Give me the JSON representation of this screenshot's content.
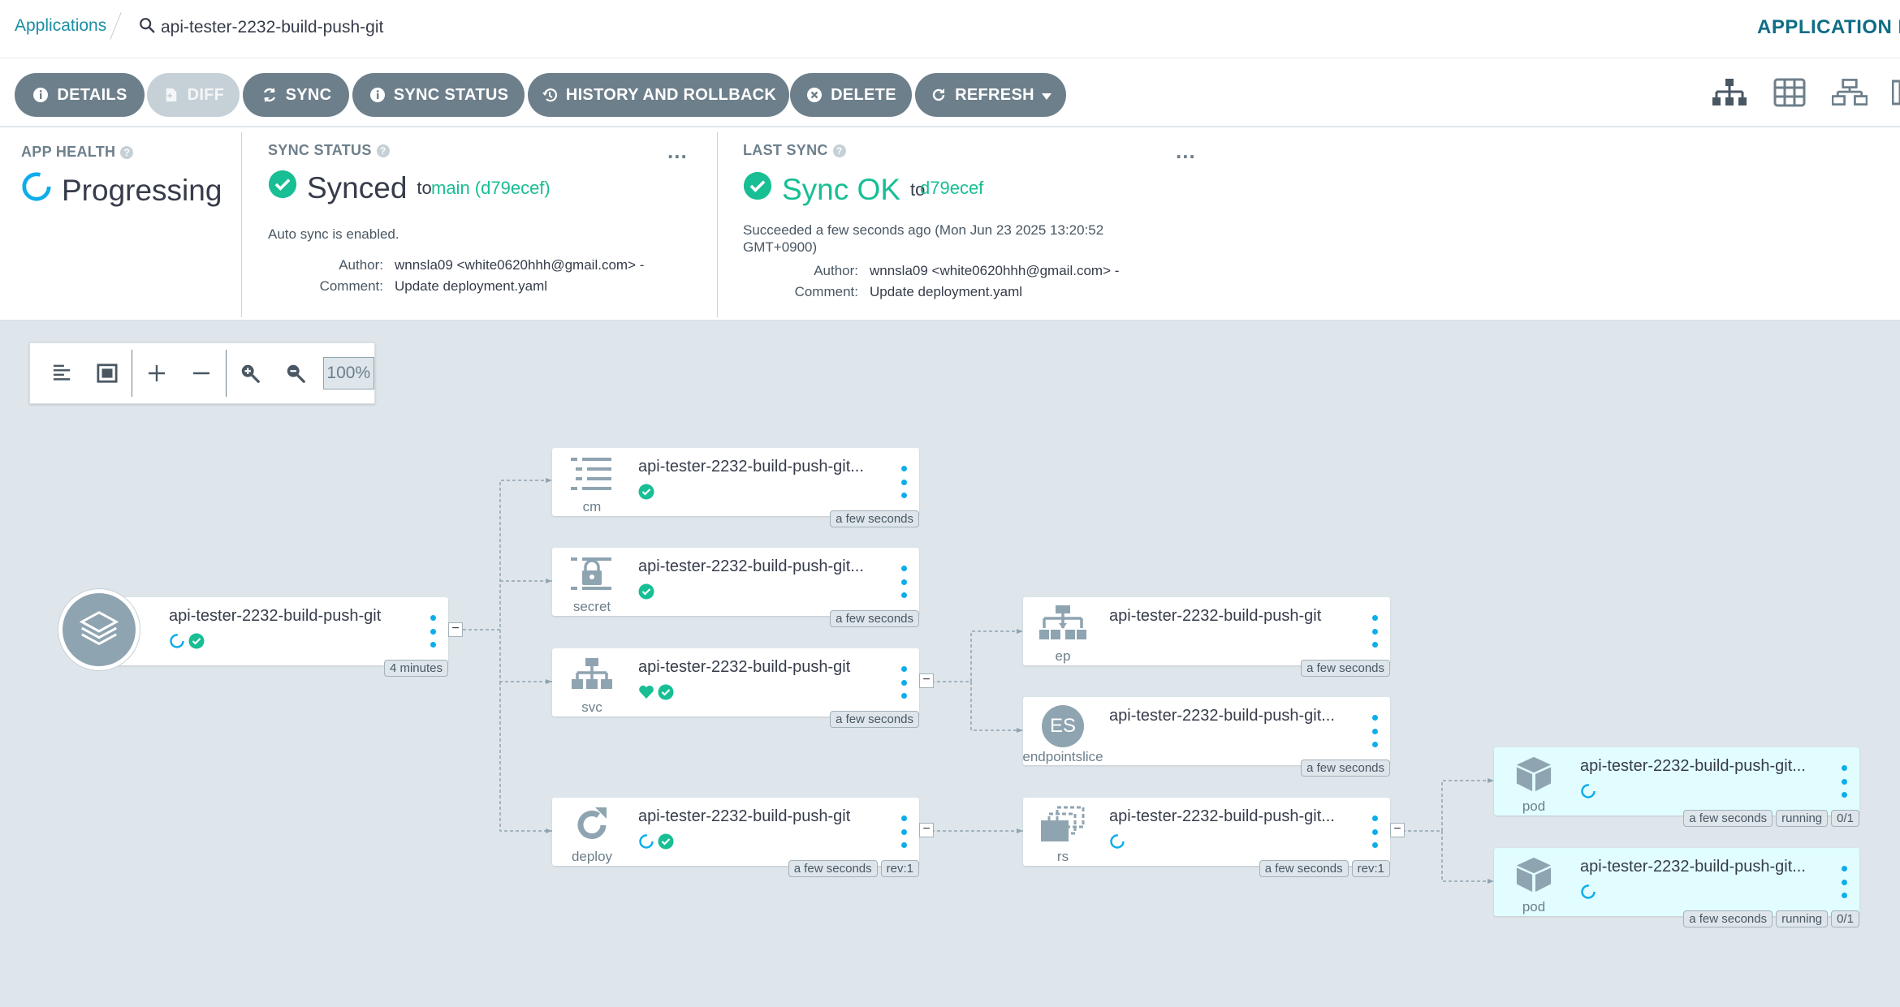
{
  "header": {
    "breadcrumb_link": "Applications",
    "search_text": "api-tester-2232-build-push-git",
    "page_title": "APPLICATION DETAILS"
  },
  "toolbar": {
    "details": "DETAILS",
    "diff": "DIFF",
    "sync": "SYNC",
    "sync_status": "SYNC STATUS",
    "history": "HISTORY AND ROLLBACK",
    "delete": "DELETE",
    "refresh": "REFRESH"
  },
  "app_health": {
    "label": "APP HEALTH",
    "status": "Progressing"
  },
  "sync_status": {
    "label": "SYNC STATUS",
    "status": "Synced",
    "to_text": "to",
    "revision": "main (d79ecef)",
    "auto_sync": "Auto sync is enabled.",
    "author_label": "Author:",
    "author": "wnnsla09 <white0620hhh@gmail.com> -",
    "comment_label": "Comment:",
    "comment": "Update deployment.yaml",
    "more": "..."
  },
  "last_sync": {
    "label": "LAST SYNC",
    "status": "Sync OK",
    "to_text": "to",
    "revision": "d79ecef",
    "succeeded_line1": "Succeeded a few seconds ago (Mon Jun 23 2025 13:20:52",
    "succeeded_line2": "GMT+0900)",
    "author_label": "Author:",
    "author": "wnnsla09 <white0620hhh@gmail.com> -",
    "comment_label": "Comment:",
    "comment": "Update deployment.yaml",
    "more": "..."
  },
  "zoom": {
    "level": "100%"
  },
  "nodes": {
    "app": {
      "name": "api-tester-2232-build-push-git",
      "age": "4 minutes"
    },
    "cm": {
      "name": "api-tester-2232-build-push-git...",
      "kind": "cm",
      "age": "a few seconds"
    },
    "secret": {
      "name": "api-tester-2232-build-push-git...",
      "kind": "secret",
      "age": "a few seconds"
    },
    "svc": {
      "name": "api-tester-2232-build-push-git",
      "kind": "svc",
      "age": "a few seconds"
    },
    "deploy": {
      "name": "api-tester-2232-build-push-git",
      "kind": "deploy",
      "age": "a few seconds",
      "rev": "rev:1"
    },
    "ep": {
      "name": "api-tester-2232-build-push-git",
      "kind": "ep",
      "age": "a few seconds"
    },
    "es": {
      "name": "api-tester-2232-build-push-git...",
      "kind": "endpointslice",
      "badge": "ES",
      "age": "a few seconds"
    },
    "rs": {
      "name": "api-tester-2232-build-push-git...",
      "kind": "rs",
      "age": "a few seconds",
      "rev": "rev:1"
    },
    "pod1": {
      "name": "api-tester-2232-build-push-git...",
      "kind": "pod",
      "age": "a few seconds",
      "state": "running",
      "ready": "0/1"
    },
    "pod2": {
      "name": "api-tester-2232-build-push-git...",
      "kind": "pod",
      "age": "a few seconds",
      "state": "running",
      "ready": "0/1"
    }
  },
  "colors": {
    "accent": "#1b8fa4",
    "synced": "#18be94",
    "progressing": "#0dadea",
    "button": "#6d7f8b",
    "graph_bg": "#dee6eb",
    "pod_bg": "#e1fdff"
  }
}
